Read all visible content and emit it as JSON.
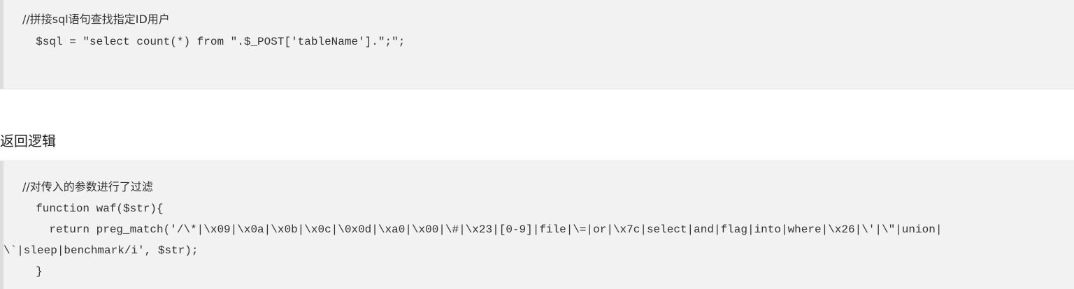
{
  "block1": {
    "comment": "//拼接sql语句查找指定ID用户",
    "line1": "  $sql = \"select count(*) from \".$_POST['tableName'].\";\";"
  },
  "heading": "返回逻辑",
  "block2": {
    "comment": "//对传入的参数进行了过滤",
    "line1": "  function waf($str){",
    "line2": "    return preg_match('/\\*|\\x09|\\x0a|\\x0b|\\x0c|\\0x0d|\\xa0|\\x00|\\#|\\x23|[0-9]|file|\\=|or|\\x7c|select|and|flag|into|where|\\x26|\\'|\\\"|union|",
    "line3": "\\`|sleep|benchmark/i', $str);",
    "line4": "  }"
  }
}
